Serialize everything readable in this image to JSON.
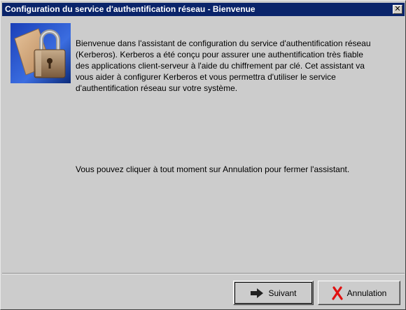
{
  "window": {
    "title": "Configuration du service d'authentification réseau - Bienvenue",
    "close_symbol": "✕"
  },
  "main": {
    "logo_icon": "padlock-card-icon",
    "welcome_text": "Bienvenue dans l'assistant de configuration du service d'authentification réseau\n(Kerberos). Kerberos a été conçu pour assurer une authentification très fiable\ndes applications client-serveur à l'aide du chiffrement par clé. Cet assistant va\nvous aider à configurer Kerberos et vous permettra d'utiliser le service\nd'authentification réseau sur votre système.",
    "cancel_hint": "Vous pouvez cliquer à tout moment sur Annulation pour fermer l'assistant."
  },
  "buttons": {
    "next_label": "Suivant",
    "next_icon": "right-arrow-icon",
    "cancel_label": "Annulation",
    "cancel_icon": "red-x-icon"
  },
  "colors": {
    "titlebar": "#0a246a",
    "window_bg": "#cccccc",
    "cancel_x": "#e01010"
  }
}
